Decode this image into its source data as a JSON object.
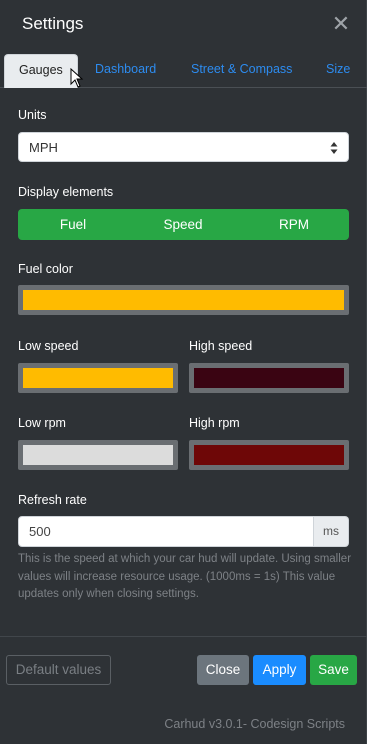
{
  "header": {
    "title": "Settings",
    "close_icon": "close-icon"
  },
  "tabs": [
    {
      "label": "Gauges",
      "active": true
    },
    {
      "label": "Dashboard",
      "active": false
    },
    {
      "label": "Street & Compass",
      "active": false
    },
    {
      "label": "Size",
      "active": false
    }
  ],
  "units": {
    "label": "Units",
    "value": "MPH"
  },
  "display_elements": {
    "label": "Display elements",
    "options": [
      "Fuel",
      "Speed",
      "RPM"
    ]
  },
  "fuel_color": {
    "label": "Fuel color",
    "color": "#ffbb00"
  },
  "low_speed": {
    "label": "Low speed",
    "color": "#ffbb00"
  },
  "high_speed": {
    "label": "High speed",
    "color": "#3a0412"
  },
  "low_rpm": {
    "label": "Low rpm",
    "color": "#dcdcdc"
  },
  "high_rpm": {
    "label": "High rpm",
    "color": "#6e0707"
  },
  "refresh_rate": {
    "label": "Refresh rate",
    "value": "500",
    "unit": "ms",
    "help": "This is the speed at which your car hud will update. Using smaller values will increase resource usage. (1000ms = 1s) This value updates only when closing settings."
  },
  "buttons": {
    "default": "Default values",
    "close": "Close",
    "apply": "Apply",
    "save": "Save"
  },
  "footer": "Carhud v3.0.1- Codesign Scripts",
  "colors": {
    "accent_blue": "#1a8cff",
    "success_green": "#28a745",
    "secondary_gray": "#6c757d",
    "background": "#2e3236"
  }
}
